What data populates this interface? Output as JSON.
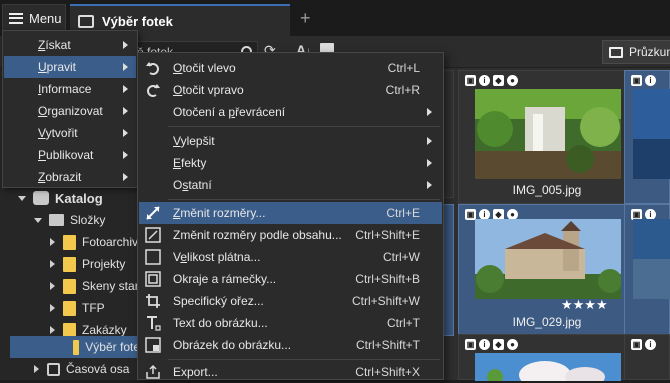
{
  "header": {
    "menu_label": "Menu",
    "tab_title": "Výběr fotek",
    "new_tab": "+"
  },
  "toolbar": {
    "search_value": "ě fotek",
    "sort_label": "A",
    "pruzkum_label": "Průzkum"
  },
  "main_menu": {
    "items": [
      {
        "label": "Získat",
        "ul": "Z",
        "rest": "ískat"
      },
      {
        "label": "Upravit",
        "ul": "U",
        "rest": "pravit"
      },
      {
        "label": "Informace",
        "ul": "I",
        "rest": "nformace"
      },
      {
        "label": "Organizovat",
        "ul": "O",
        "rest": "rganizovat"
      },
      {
        "label": "Vytvořit",
        "ul": "V",
        "rest": "ytvořit"
      },
      {
        "label": "Publikovat",
        "ul": "P",
        "rest": "ublikovat"
      },
      {
        "label": "Zobrazit",
        "ul": "Z",
        "rest": "obrazit"
      }
    ]
  },
  "submenu": {
    "items": [
      {
        "pre": "",
        "ul": "O",
        "post": "točit vlevo",
        "shortcut": "Ctrl+L"
      },
      {
        "pre": "",
        "ul": "O",
        "post": "točit vpravo",
        "shortcut": "Ctrl+R"
      },
      {
        "pre": "Otočení a ",
        "ul": "p",
        "post": "řevrácení",
        "shortcut": ""
      },
      {
        "pre": "",
        "ul": "V",
        "post": "ylepšit",
        "shortcut": ""
      },
      {
        "pre": "",
        "ul": "E",
        "post": "fekty",
        "shortcut": ""
      },
      {
        "pre": "O",
        "ul": "s",
        "post": "tatní",
        "shortcut": ""
      },
      {
        "pre": "",
        "ul": "Z",
        "post": "měnit rozměry...",
        "shortcut": "Ctrl+E"
      },
      {
        "pre": "Změnit rozměry podle obsahu...",
        "ul": "",
        "post": "",
        "shortcut": "Ctrl+Shift+E"
      },
      {
        "pre": "V",
        "ul": "e",
        "post": "likost plátna...",
        "shortcut": "Ctrl+W"
      },
      {
        "pre": "Okraje a rámečky...",
        "ul": "",
        "post": "",
        "shortcut": "Ctrl+Shift+B"
      },
      {
        "pre": "Specifický ořez...",
        "ul": "",
        "post": "",
        "shortcut": "Ctrl+Shift+W"
      },
      {
        "pre": "Text do obrázku...",
        "ul": "",
        "post": "",
        "shortcut": "Ctrl+T"
      },
      {
        "pre": "Obrázek do obrázku...",
        "ul": "",
        "post": "",
        "shortcut": "Ctrl+Shift+T"
      },
      {
        "pre": "Export...",
        "ul": "",
        "post": "",
        "shortcut": "Ctrl+Shift+X"
      }
    ]
  },
  "tree": {
    "catalog": "Katalog",
    "slozky": "Složky",
    "folders": [
      "Fotoarchiv",
      "Projekty",
      "Skeny star",
      "TFP",
      "Zakázky",
      "Výběr fote"
    ],
    "casova_osa": "Časová osa"
  },
  "thumbs": {
    "top_label": "IMG_005.jpg",
    "mid_label": "IMG_029.jpg"
  }
}
